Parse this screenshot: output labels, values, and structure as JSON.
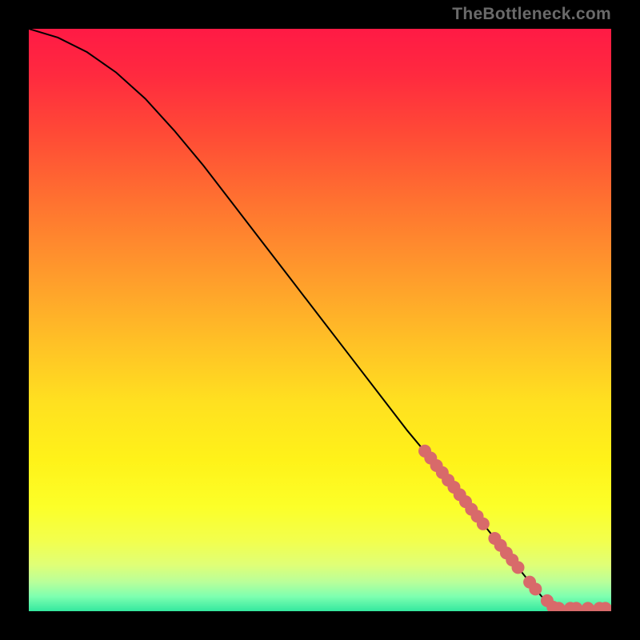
{
  "watermark": "TheBottleneck.com",
  "chart_data": {
    "type": "line",
    "title": "",
    "xlabel": "",
    "ylabel": "",
    "xlim": [
      0,
      100
    ],
    "ylim": [
      0,
      100
    ],
    "grid": false,
    "legend": false,
    "series": [
      {
        "name": "curve",
        "x": [
          0,
          5,
          10,
          15,
          20,
          25,
          30,
          35,
          40,
          45,
          50,
          55,
          60,
          65,
          70,
          72,
          74,
          76,
          78,
          80,
          82,
          84,
          86,
          88,
          90,
          92,
          94,
          96,
          98,
          100
        ],
        "y": [
          100,
          98.5,
          96,
          92.5,
          88,
          82.5,
          76.5,
          70,
          63.5,
          57,
          50.5,
          44,
          37.5,
          31,
          25,
          22.5,
          20,
          17.5,
          15,
          12.5,
          10,
          7.5,
          5,
          2.6,
          0.7,
          0.5,
          0.5,
          0.5,
          0.5,
          0.5
        ],
        "color": "#000000",
        "width": 2
      }
    ],
    "scatter": [
      {
        "name": "markers",
        "x": [
          68,
          69,
          70,
          71,
          72,
          73,
          74,
          75,
          76,
          77,
          78,
          80,
          81,
          82,
          83,
          84,
          86,
          87,
          89,
          90,
          91,
          93,
          94,
          96,
          98,
          99
        ],
        "y": [
          27.5,
          26.3,
          25,
          23.8,
          22.5,
          21.3,
          20,
          18.8,
          17.5,
          16.3,
          15,
          12.5,
          11.3,
          10,
          8.8,
          7.5,
          5,
          3.8,
          1.8,
          0.7,
          0.5,
          0.5,
          0.5,
          0.5,
          0.5,
          0.5
        ],
        "color": "#d86a6a",
        "size": 8
      }
    ],
    "gradient": {
      "stops": [
        {
          "offset": 0.0,
          "color": "#ff1a45"
        },
        {
          "offset": 0.08,
          "color": "#ff2a3f"
        },
        {
          "offset": 0.18,
          "color": "#ff4a36"
        },
        {
          "offset": 0.3,
          "color": "#ff7330"
        },
        {
          "offset": 0.42,
          "color": "#ff9a2c"
        },
        {
          "offset": 0.54,
          "color": "#ffc126"
        },
        {
          "offset": 0.64,
          "color": "#ffe020"
        },
        {
          "offset": 0.74,
          "color": "#fff219"
        },
        {
          "offset": 0.82,
          "color": "#fcff28"
        },
        {
          "offset": 0.88,
          "color": "#f2ff4e"
        },
        {
          "offset": 0.92,
          "color": "#e0ff76"
        },
        {
          "offset": 0.95,
          "color": "#b9ff9a"
        },
        {
          "offset": 0.975,
          "color": "#7dffb0"
        },
        {
          "offset": 1.0,
          "color": "#34e89f"
        }
      ]
    }
  }
}
